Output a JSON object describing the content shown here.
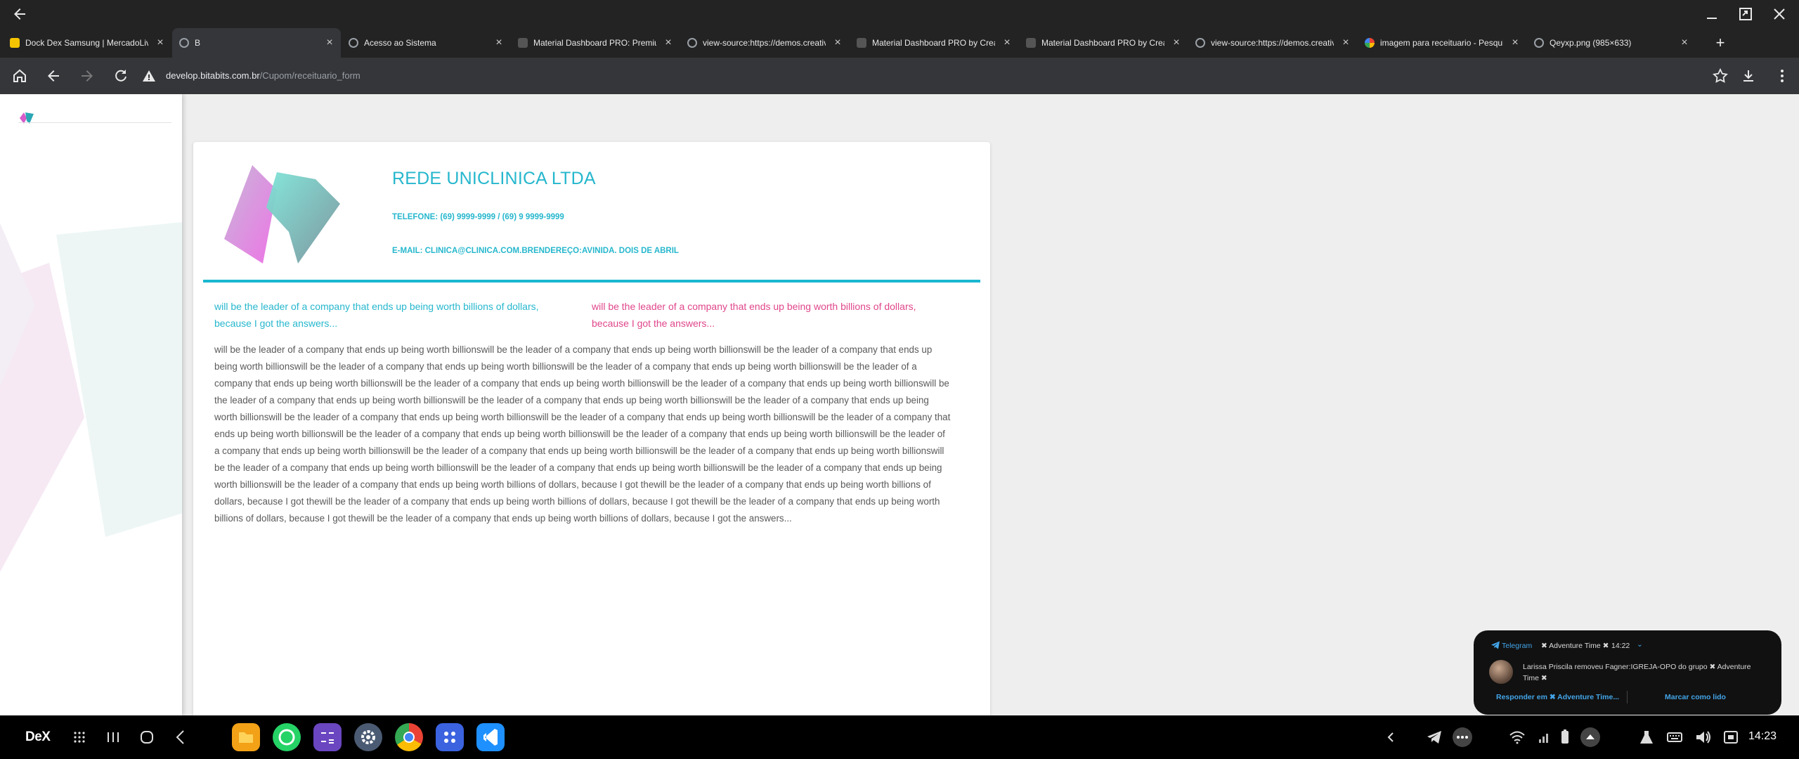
{
  "browser": {
    "tabs": [
      {
        "title": "Dock Dex Samsung | MercadoLivre",
        "favicon_color": "#f5c400",
        "active": false
      },
      {
        "title": "B",
        "favicon_color": "#9aa0a6",
        "active": true
      },
      {
        "title": "Acesso ao Sistema",
        "favicon_color": "#9aa0a6",
        "active": false
      },
      {
        "title": "Material Dashboard PRO: Premium",
        "favicon_color": "#333333",
        "active": false
      },
      {
        "title": "view-source:https://demos.creative",
        "favicon_color": "#9aa0a6",
        "active": false
      },
      {
        "title": "Material Dashboard PRO by Creative",
        "favicon_color": "#333333",
        "active": false
      },
      {
        "title": "Material Dashboard PRO by Creative",
        "favicon_color": "#333333",
        "active": false
      },
      {
        "title": "view-source:https://demos.creative",
        "favicon_color": "#9aa0a6",
        "active": false
      },
      {
        "title": "imagem para receituario - Pesquisa",
        "favicon_color": "#4285f4",
        "active": false
      },
      {
        "title": "Qeyxp.png (985×633)",
        "favicon_color": "#9aa0a6",
        "active": false
      }
    ],
    "url_host": "develop.bitabits.com.br",
    "url_path": "/Cupom/receituario_form",
    "new_tab_label": "+"
  },
  "document": {
    "company": "REDE UNICLINICA LTDA",
    "phone_line": "TELEFONE: (69) 9999-9999 / (69) 9 9999-9999",
    "email_line": "E-MAIL: CLINICA@CLINICA.COM.BRENDEREÇO:AVINIDA. DOIS DE ABRIL",
    "col_left": "will be the leader of a company that ends up being worth billions of dollars, because I got the answers...",
    "col_right": "will be the leader of a company that ends up being worth billions of dollars, because I got the answers...",
    "body": "will be the leader of a company that ends up being worth billionswill be the leader of a company that ends up being worth billionswill be the leader of a company that ends up being worth billionswill be the leader of a company that ends up being worth billionswill be the leader of a company that ends up being worth billionswill be the leader of a company that ends up being worth billionswill be the leader of a company that ends up being worth billionswill be the leader of a company that ends up being worth billionswill be the leader of a company that ends up being worth billionswill be the leader of a company that ends up being worth billionswill be the leader of a company that ends up being worth billionswill be the leader of a company that ends up being worth billionswill be the leader of a company that ends up being worth billionswill be the leader of a company that ends up being worth billionswill be the leader of a company that ends up being worth billionswill be the leader of a company that ends up being worth billionswill be the leader of a company that ends up being worth billionswill be the leader of a company that ends up being worth billionswill be the leader of a company that ends up being worth billionswill be the leader of a company that ends up being worth billionswill be the leader of a company that ends up being worth billionswill be the leader of a company that ends up being worth billionswill be the leader of a company that ends up being worth billions of dollars, because I got thewill be the leader of a company that ends up being worth billions of dollars, because I got thewill be the leader of a company that ends up being worth billions of dollars, because I got thewill be the leader of a company that ends up being worth billions of dollars, because I got thewill be the leader of a company that ends up being worth billions of dollars, because I got the answers..."
  },
  "notification": {
    "app": "Telegram",
    "group": "✖ Adventure Time ✖",
    "time": "14:22",
    "chevron": "⌄",
    "message": "Larissa Priscila removeu Fagner:IGREJA-OPO do grupo ✖ Adventure Time ✖",
    "reply_action": "Responder em ✖ Adventure Time...",
    "mark_read_action": "Marcar como lido"
  },
  "taskbar": {
    "dex_label": "DeX",
    "clock": "14:23"
  },
  "colors": {
    "accent_cyan": "#26b7cd",
    "accent_pink": "#e0468b",
    "telegram_blue": "#43a5e8"
  }
}
